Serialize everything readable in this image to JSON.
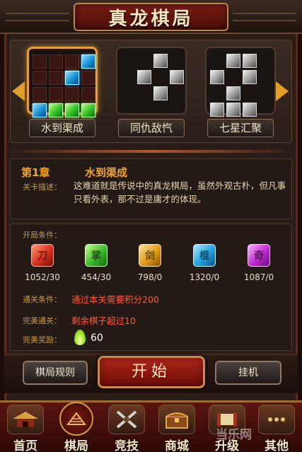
{
  "title": "真龙棋局",
  "puzzles": [
    {
      "label": "水到渠成",
      "selected": true,
      "grid": [
        "e",
        "e",
        "e",
        "b",
        "e",
        "e",
        "b",
        "e",
        "e",
        "e",
        "e",
        "e",
        "b",
        "g",
        "g",
        "g"
      ]
    },
    {
      "label": "同仇敌忾",
      "selected": false,
      "grid": [
        "e",
        "e",
        "s",
        "e",
        "e",
        "s",
        "e",
        "s",
        "e",
        "e",
        "s",
        "e",
        "e",
        "e",
        "e",
        "e"
      ]
    },
    {
      "label": "七星汇聚",
      "selected": false,
      "grid": [
        "e",
        "s",
        "s",
        "e",
        "s",
        "e",
        "s",
        "e",
        "e",
        "s",
        "e",
        "e",
        "s",
        "s",
        "s",
        "e"
      ]
    }
  ],
  "chapter": {
    "number": "第1章",
    "name": "水到渠成",
    "desc_label": "关卡描述：",
    "description": "这难道就是传说中的真龙棋局，虽然外观古朴，但凡事只看外表，那不过是庸才的体现。"
  },
  "conditions": {
    "label": "开局条件：",
    "items": [
      {
        "icon": "red-gem-icon",
        "glyph": "刀",
        "count": "1052/30"
      },
      {
        "icon": "green-gem-icon",
        "glyph": "掌",
        "count": "454/30"
      },
      {
        "icon": "orange-gem-icon",
        "glyph": "剑",
        "count": "798/0"
      },
      {
        "icon": "blue-gem-icon",
        "glyph": "棍",
        "count": "1320/0"
      },
      {
        "icon": "purple-gem-icon",
        "glyph": "奇",
        "count": "1087/0"
      }
    ],
    "pass_label": "通关条件：",
    "pass_value": "通过本关需要积分200",
    "perfect_label": "完美通关：",
    "perfect_value": "剩余棋子超过10",
    "reward_label": "完美奖励：",
    "reward_value": "60"
  },
  "actions": {
    "rules": "棋局规则",
    "start": "开始",
    "hangup": "挂机"
  },
  "nav": [
    {
      "label": "首页",
      "icon": "pagoda-icon",
      "active": false
    },
    {
      "label": "棋局",
      "icon": "chessboard-icon",
      "active": true
    },
    {
      "label": "竞技",
      "icon": "crossed-swords-icon",
      "active": false
    },
    {
      "label": "商城",
      "icon": "treasure-chest-icon",
      "active": false
    },
    {
      "label": "升级",
      "icon": "scroll-icon",
      "active": false
    },
    {
      "label": "其他",
      "icon": "more-icon",
      "active": false
    }
  ],
  "watermark": "当乐网"
}
